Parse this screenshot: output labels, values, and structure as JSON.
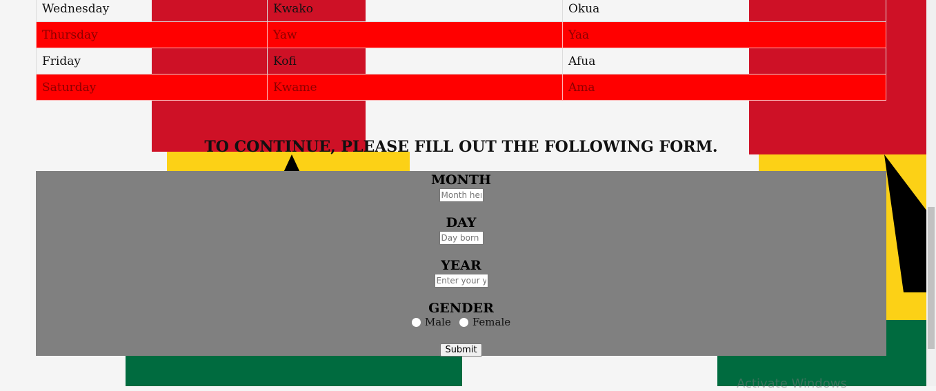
{
  "table": {
    "rows": [
      {
        "day": "Wednesday",
        "male": "Kwako",
        "female": "Okua",
        "style": "white"
      },
      {
        "day": "Thursday",
        "male": "Yaw",
        "female": "Yaa",
        "style": "red"
      },
      {
        "day": "Friday",
        "male": "Kofi",
        "female": "Afua",
        "style": "white"
      },
      {
        "day": "Saturday",
        "male": "Kwame",
        "female": "Ama",
        "style": "red"
      }
    ]
  },
  "form": {
    "heading": "TO CONTINUE, PLEASE FILL OUT THE FOLLOWING FORM.",
    "month_label": "MONTH",
    "month_placeholder": "Month here",
    "day_label": "DAY",
    "day_placeholder": "Day born",
    "year_label": "YEAR",
    "year_placeholder": "Enter your year",
    "gender_label": "GENDER",
    "male_label": "Male",
    "female_label": "Female",
    "submit_label": "Submit"
  },
  "watermark": "Activate Windows",
  "colors": {
    "red": "#ce1126",
    "bright_red": "#ff0000",
    "yellow": "#fcd116",
    "green": "#006b3f",
    "form_bg": "#808080"
  }
}
